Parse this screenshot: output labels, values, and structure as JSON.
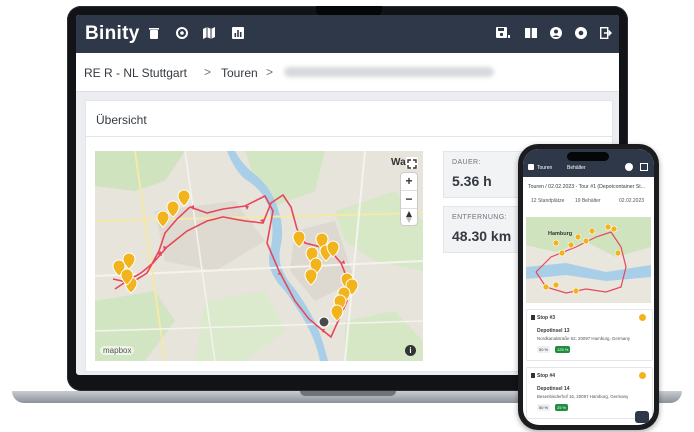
{
  "app": {
    "brand": "Binity"
  },
  "breadcrumb": {
    "root": "RE R - NL Stuttgart",
    "separator": ">",
    "section": "Touren",
    "separator2": ">"
  },
  "overview": {
    "title": "Übersicht"
  },
  "map": {
    "attribution": "mapbox",
    "place_label": "Wa",
    "info_glyph": "i",
    "zoom_in": "+",
    "zoom_out": "−"
  },
  "stats": [
    {
      "label": "DAUER:",
      "value": "5.36 h"
    },
    {
      "label": "ENTFERNUNG:",
      "value": "48.30 km"
    }
  ],
  "phone": {
    "tabs": [
      "Touren",
      "Behälter"
    ],
    "crumb": "Touren / 02.02.2023 - Tour #1 (Depotcontainer St...",
    "meta": [
      "12 Standplätze",
      "19 Behälter",
      "02.02.2023"
    ],
    "map_label": "Hamburg",
    "stops": [
      {
        "title": "Stop #3",
        "name": "Depotinsel 13",
        "address": "Nordkanalstraße 52, 20097 Hamburg, Germany",
        "fill": "50 %",
        "extra": "125 %"
      },
      {
        "title": "Stop #4",
        "name": "Depotinsel 14",
        "address": "Besenbinderhof 16, 20097 Hamburg, Germany",
        "fill": "50 %",
        "extra": "25 %"
      }
    ]
  },
  "colors": {
    "appbar": "#2f3848",
    "route": "#e8475a",
    "marker": "#f2b41c",
    "badge_green": "#1e8e3e"
  },
  "icons": [
    "trash-icon",
    "circle-icon",
    "map-icon",
    "chart-icon",
    "save-icon",
    "book-icon",
    "user-icon",
    "settings-icon",
    "logout-icon",
    "fullscreen-icon",
    "compass-icon",
    "info-icon"
  ]
}
